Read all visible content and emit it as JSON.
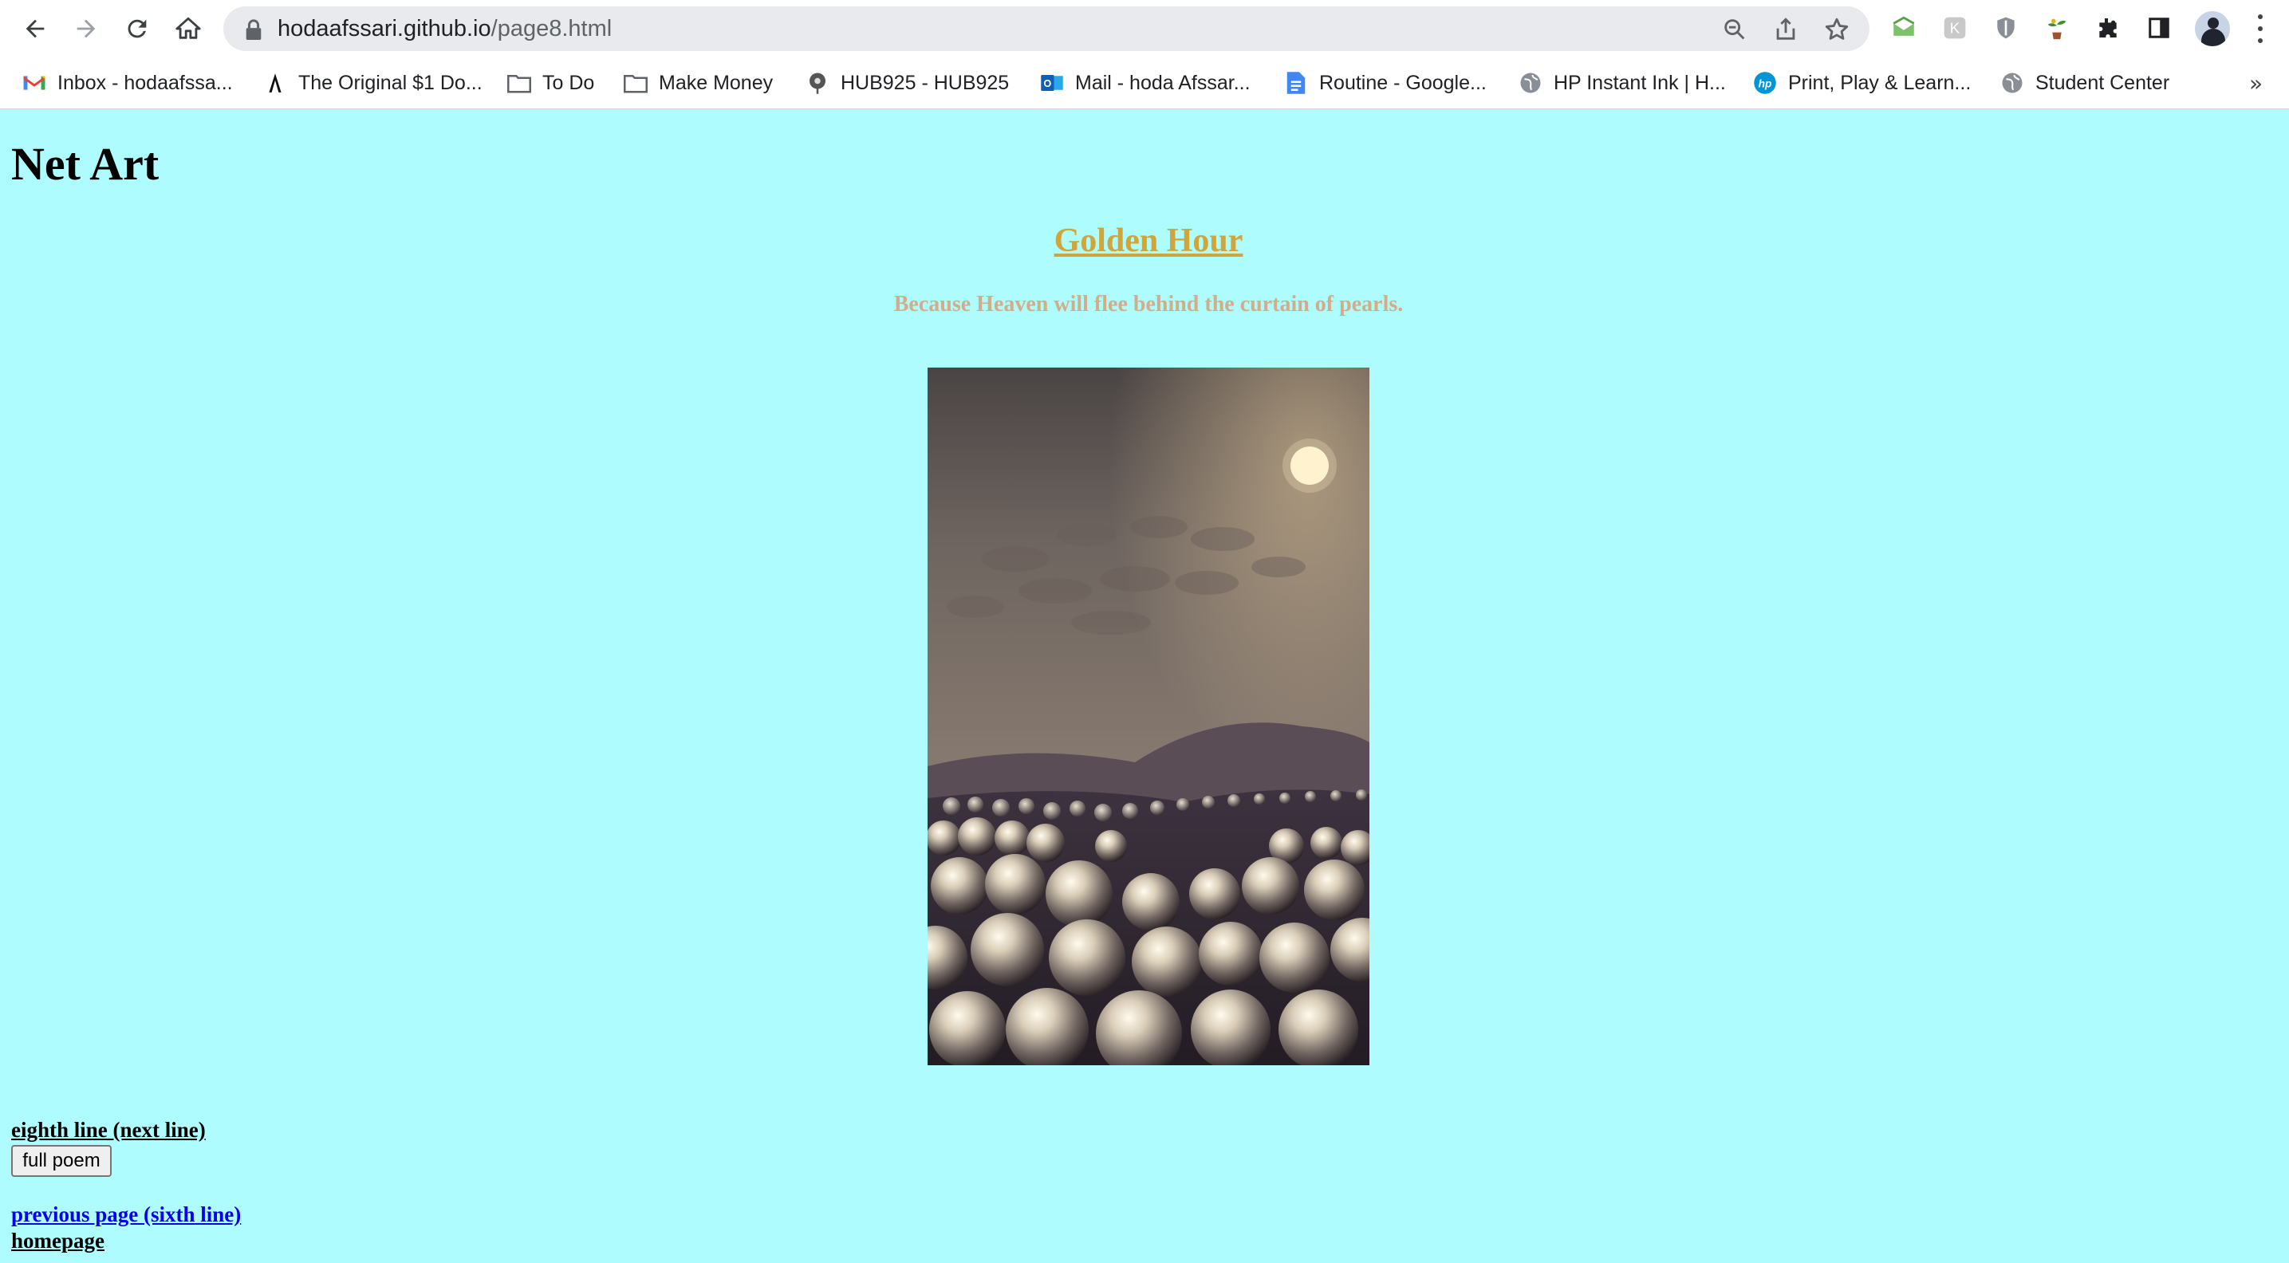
{
  "browser": {
    "url_host": "hodaafssari.github.io",
    "url_path": "/page8.html",
    "bookmarks": [
      {
        "label": "Inbox - hodaafssa...",
        "icon": "gmail-icon"
      },
      {
        "label": "The Original $1 Do...",
        "icon": "a-logo-icon"
      },
      {
        "label": "To Do",
        "icon": "folder-icon"
      },
      {
        "label": "Make Money",
        "icon": "folder-icon"
      },
      {
        "label": "HUB925 - HUB925",
        "icon": "hub-icon"
      },
      {
        "label": "Mail - hoda Afssar...",
        "icon": "outlook-icon"
      },
      {
        "label": "Routine - Google...",
        "icon": "google-docs-icon"
      },
      {
        "label": "HP Instant Ink | H...",
        "icon": "globe-icon"
      },
      {
        "label": "Print, Play & Learn...",
        "icon": "hp-icon"
      },
      {
        "label": "Student Center",
        "icon": "globe-icon"
      }
    ],
    "more_bookmarks": "»"
  },
  "page": {
    "heading": "Net Art",
    "poem_title": "Golden Hour",
    "subtitle": "Because Heaven will flee behind the curtain of pearls.",
    "image_alt": "pearls under a hazy golden sky",
    "next_line_link": "eighth line (next line)",
    "full_poem_button": "full poem",
    "previous_link": "previous page (sixth line)",
    "home_link": "homepage"
  },
  "colors": {
    "background": "#aefcfd",
    "poem_title": "#d0a539",
    "subtitle": "#d1ad8b",
    "visited_link": "#0000ee"
  }
}
